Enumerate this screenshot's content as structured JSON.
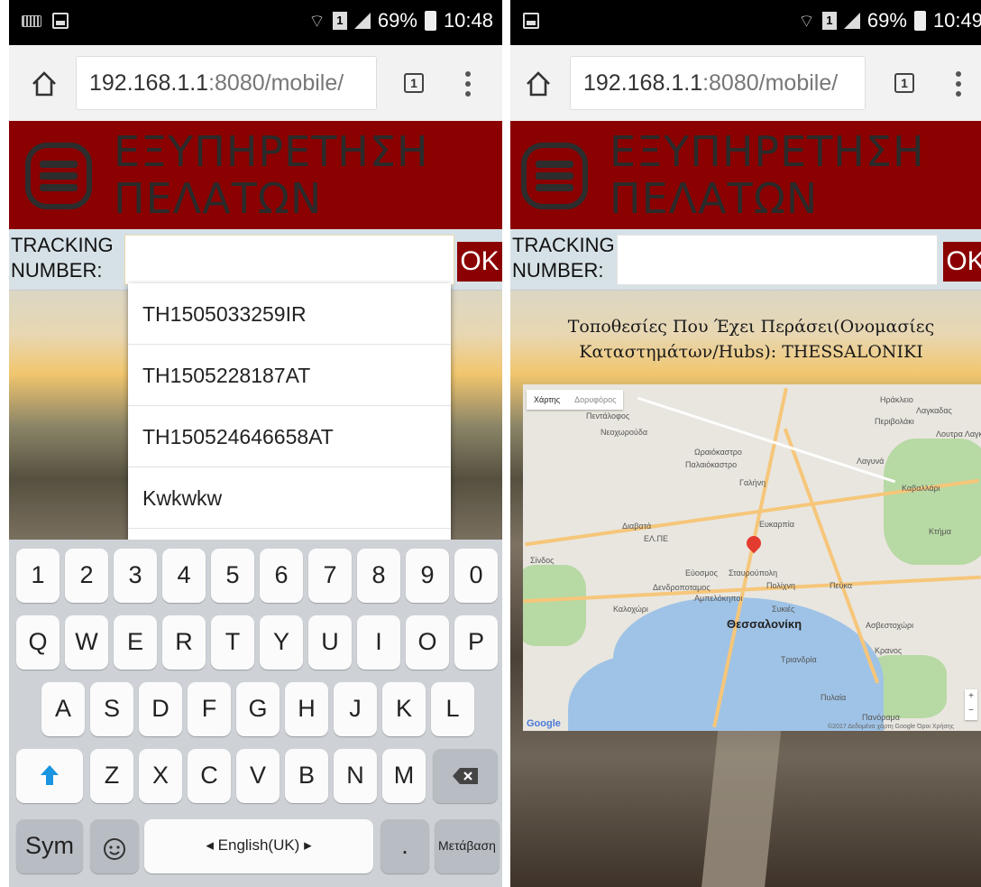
{
  "left": {
    "status": {
      "battery": "69%",
      "time": "10:48"
    },
    "browser": {
      "url_host": "192.168.1.1",
      "url_rest": ":8080/mobile/",
      "tab_count": "1"
    },
    "header": {
      "title_line1": "ΕΞΥΠΗΡΕΤΗΣΗ",
      "title_line2": "ΠΕΛΑΤΩΝ"
    },
    "tracking": {
      "label_line1": "TRACKING",
      "label_line2": "NUMBER:",
      "value": "",
      "ok_label": "OK"
    },
    "suggestions": [
      "TH1505033259IR",
      " TH1505228187AT",
      "  TH150524646658AT",
      "Kwkwkw"
    ],
    "keyboard": {
      "row_numbers": [
        "1",
        "2",
        "3",
        "4",
        "5",
        "6",
        "7",
        "8",
        "9",
        "0"
      ],
      "row_q": [
        "Q",
        "W",
        "E",
        "R",
        "T",
        "Y",
        "U",
        "I",
        "O",
        "P"
      ],
      "row_a": [
        "A",
        "S",
        "D",
        "F",
        "G",
        "H",
        "J",
        "K",
        "L"
      ],
      "row_z": [
        "Z",
        "X",
        "C",
        "V",
        "B",
        "N",
        "M"
      ],
      "sym_label": "Sym",
      "space_label": "◂   English(UK)   ▸",
      "period_label": ".",
      "go_label": "Μετάβαση"
    }
  },
  "right": {
    "status": {
      "battery": "69%",
      "time": "10:49"
    },
    "browser": {
      "url_host": "192.168.1.1",
      "url_rest": ":8080/mobile/",
      "tab_count": "1"
    },
    "header": {
      "title_line1": "ΕΞΥΠΗΡΕΤΗΣΗ",
      "title_line2": "ΠΕΛΑΤΩΝ"
    },
    "tracking": {
      "label_line1": "TRACKING",
      "label_line2": "NUMBER:",
      "value": "",
      "ok_label": "OK"
    },
    "locations": "Τοποθεσίες Που Έχει Περάσει(Ονομασίες Καταστημάτων/Hubs): THESSALONIKI",
    "map": {
      "type_map": "Χάρτης",
      "type_satellite": "Δορυφόρος",
      "city_label": "Θεσσαλονίκη",
      "labels": [
        "Πεντάλοφος",
        "Νεοχωρούδα",
        "Ωραιόκαστρο",
        "Παλαιόκαστρο",
        "Γαλήνη",
        "Λαγυνά",
        "Καβαλλάρι",
        "Διαβατά",
        "Ευκαρπία",
        "Σίνδος",
        "Εύοσμος",
        "Σταυρούπολη",
        "Πολίχνη",
        "Πεύκα",
        "Δενδροποταμος",
        "Αμπελόκηποι",
        "Συκιές",
        "Καλοχώρι",
        "Ασβεστοχώρι",
        "Κρανος",
        "Τριανδρία",
        "Πυλαία",
        "Πανόραμα",
        "ΕΛ.ΠΕ",
        "Κτήμα",
        "Περιβολάκι",
        "Ηράκλειο",
        "Λαγκαδας",
        "Λουτρα Λαγκαδά"
      ],
      "google": "Google",
      "footer": "©2017 Δεδομένα χάρτη Google  Όροι Χρήσης",
      "zoom_in": "+",
      "zoom_out": "−"
    }
  },
  "colors": {
    "header": "#8b0000",
    "ok_button": "#8b0000",
    "pin": "#e33b2e",
    "sea": "#9fc3e6",
    "shift_arrow": "#1a95e0"
  }
}
